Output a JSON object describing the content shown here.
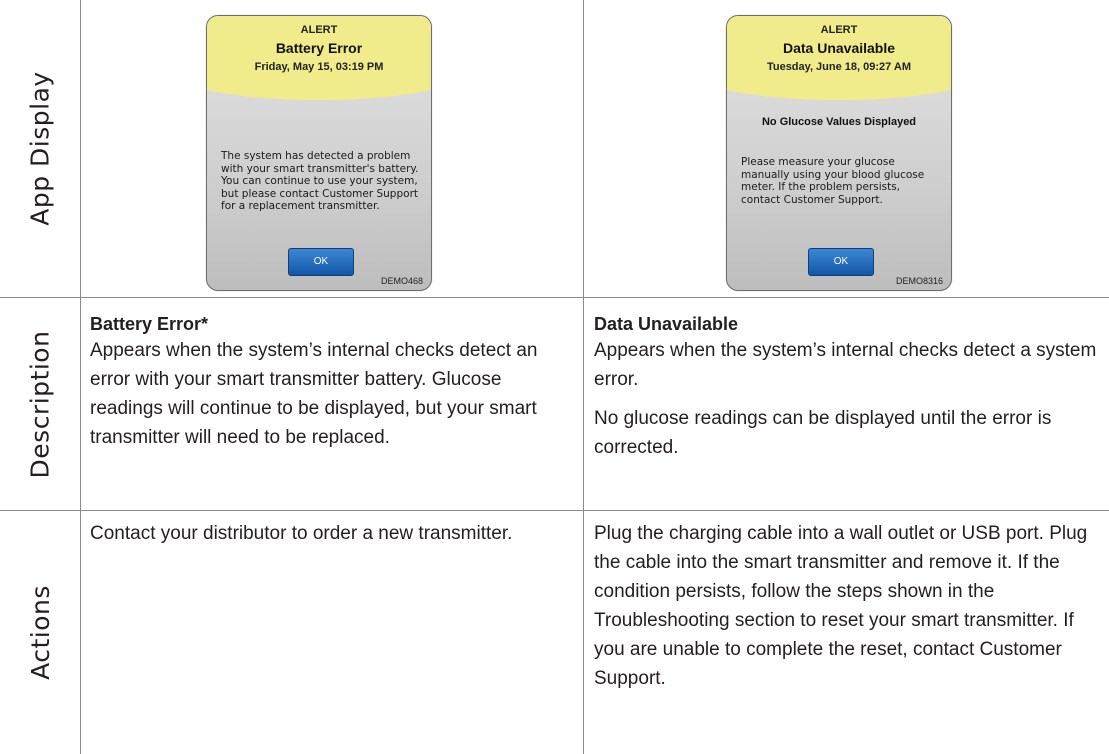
{
  "rows": {
    "app_display": "App Display",
    "description": "Description",
    "actions": "Actions"
  },
  "left": {
    "screen": {
      "alert_label": "ALERT",
      "title": "Battery Error",
      "date": "Friday, May 15, 03:19 PM",
      "body": "The system has detected a problem with your smart transmitter's battery. You can continue to use your system, but please contact Customer Support for a replacement transmitter.",
      "ok_label": "OK",
      "demo_id": "DEMO468"
    },
    "description": {
      "title": "Battery Error*",
      "text": "Appears when the system’s internal checks detect an error with your smart transmitter battery. Glucose readings will continue to be displayed, but your smart transmitter will need to be replaced."
    },
    "actions": "Contact your distributor to order a new transmitter."
  },
  "right": {
    "screen": {
      "alert_label": "ALERT",
      "title": "Data Unavailable",
      "date": "Tuesday, June 18, 09:27 AM",
      "subhead": "No Glucose Values Displayed",
      "body": "Please measure your glucose manually using your blood glucose meter. If the problem persists, contact Customer Support.",
      "ok_label": "OK",
      "demo_id": "DEMO8316"
    },
    "description": {
      "title": "Data Unavailable",
      "text": "Appears when the system’s internal checks detect a system error.",
      "text2": "No glucose readings can be displayed until the error is corrected."
    },
    "actions": "Plug the charging cable into a wall outlet or USB port. Plug the cable into the smart transmitter and remove it. If the condition persists, follow the steps shown in the Troubleshooting section to reset your smart transmitter. If you are unable to complete the reset, contact Customer Support."
  },
  "colors": {
    "alert_header": "#f0ec8c",
    "ok_button": "#1f64b8",
    "grid_line": "#8a8a8a",
    "text": "#231f20"
  }
}
